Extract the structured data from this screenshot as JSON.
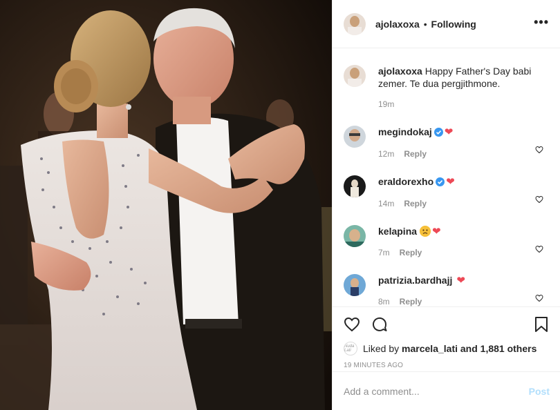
{
  "post": {
    "photo_icon": "post-photo",
    "photo_alt": "",
    "author": {
      "username": "ajolaxoxa",
      "follow_status": "Following",
      "separator": "•"
    },
    "more_label": "•••"
  },
  "caption": {
    "username": "ajolaxoxa",
    "text": "Happy Father's Day babi zemer. Te dua pergjithmone.",
    "age": "19m"
  },
  "comments": [
    {
      "username": "megindokaj",
      "verified": true,
      "text": "❤",
      "age": "12m",
      "reply_label": "Reply"
    },
    {
      "username": "eraldorexho",
      "verified": true,
      "text": "❤",
      "age": "14m",
      "reply_label": "Reply"
    },
    {
      "username": "kelapina",
      "verified": false,
      "emoji": "sad-face",
      "text": "❤",
      "age": "7m",
      "reply_label": "Reply"
    },
    {
      "username": "patrizia.bardhajj",
      "verified": false,
      "text": "❤",
      "age": "8m",
      "reply_label": "Reply"
    }
  ],
  "likes": {
    "prefix": "Liked by",
    "user": "marcela_lati",
    "rest": "and 1,881 others",
    "avatar_text": "Nuda Lati"
  },
  "timestamp": "19 MINUTES AGO",
  "add_comment": {
    "placeholder": "Add a comment...",
    "post_label": "Post"
  },
  "colors": {
    "accent_blue": "#3897f0",
    "heart_red": "#ed4956",
    "post_disabled": "#b2dffc",
    "muted": "#8e8e8e"
  }
}
